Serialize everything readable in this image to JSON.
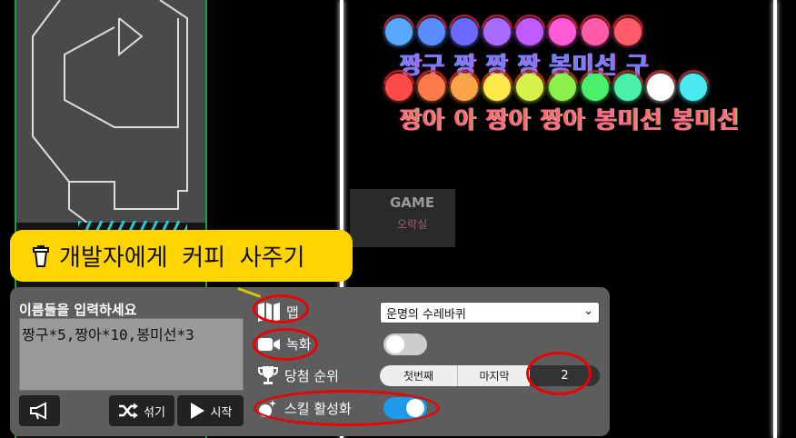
{
  "game": {
    "balls_row1": [
      "#5aa7ff",
      "#5a8cff",
      "#6a6aff",
      "#a86bff",
      "#c25bff",
      "#ff5bd9",
      "#ff5ba8",
      "#ff5b6b"
    ],
    "balls_row2": [
      "#ff4a4a",
      "#ff7a4a",
      "#ffa34a",
      "#ffe84a",
      "#d8f04a",
      "#8cf04a",
      "#4af06a",
      "#4af0a8",
      "#ffffff",
      "#4ae8f0"
    ],
    "label_row1": "짱구 짱 짱 짱 봉미선 구",
    "label_row2": "짱아 아 짱아 짱아 봉미선 봉미선",
    "watermark_top": "GAME",
    "watermark_bottom": "오락실"
  },
  "coffee_button": {
    "label": "개발자에게 커피 사주기",
    "icon": "coffee-cup-icon"
  },
  "panel": {
    "names_title": "이름들을 입력하세요",
    "names_value": "짱구*5,짱아*10,봉미선*3",
    "megaphone_icon": "megaphone-icon",
    "shuffle_label": "섞기",
    "start_label": "시작",
    "map_label": "맵",
    "map_selected": "운명의 수레바퀴",
    "record_label": "녹화",
    "record_on": false,
    "rank_label": "당첨 순위",
    "rank_first": "첫번째",
    "rank_last": "마지막",
    "rank_value": "2",
    "skill_label": "스킬 활성화",
    "skill_on": true
  }
}
